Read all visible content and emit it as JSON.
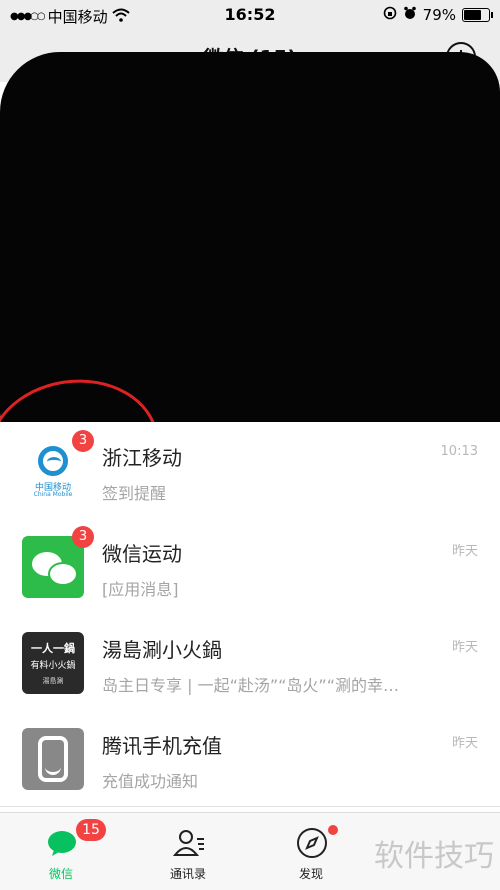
{
  "status_bar": {
    "carrier": "中国移动",
    "time": "16:52",
    "battery": "79%",
    "battery_level": 0.79
  },
  "nav": {
    "title": "微信 (15)"
  },
  "chats": [
    {
      "name": "浙江移动",
      "preview": "签到提醒",
      "time": "10:13",
      "badge": "3",
      "avatar_text": "中国移动",
      "avatar_sub": "China Mobile"
    },
    {
      "name": "微信运动",
      "preview": "[应用消息]",
      "time": "昨天",
      "badge": "3"
    },
    {
      "name": "湯島涮小火鍋",
      "preview": "岛主日专享 | 一起“赴汤”“岛火”“涮的幸…",
      "time": "昨天",
      "avatar_line1": "一人一鍋",
      "avatar_line2": "有料小火鍋",
      "avatar_line3": "湯島涮"
    },
    {
      "name": "腾讯手机充值",
      "preview": "充值成功通知",
      "time": "昨天"
    }
  ],
  "tabs": [
    {
      "label": "微信",
      "badge": "15"
    },
    {
      "label": "通讯录"
    },
    {
      "label": "发现"
    }
  ],
  "watermark": "软件技巧"
}
